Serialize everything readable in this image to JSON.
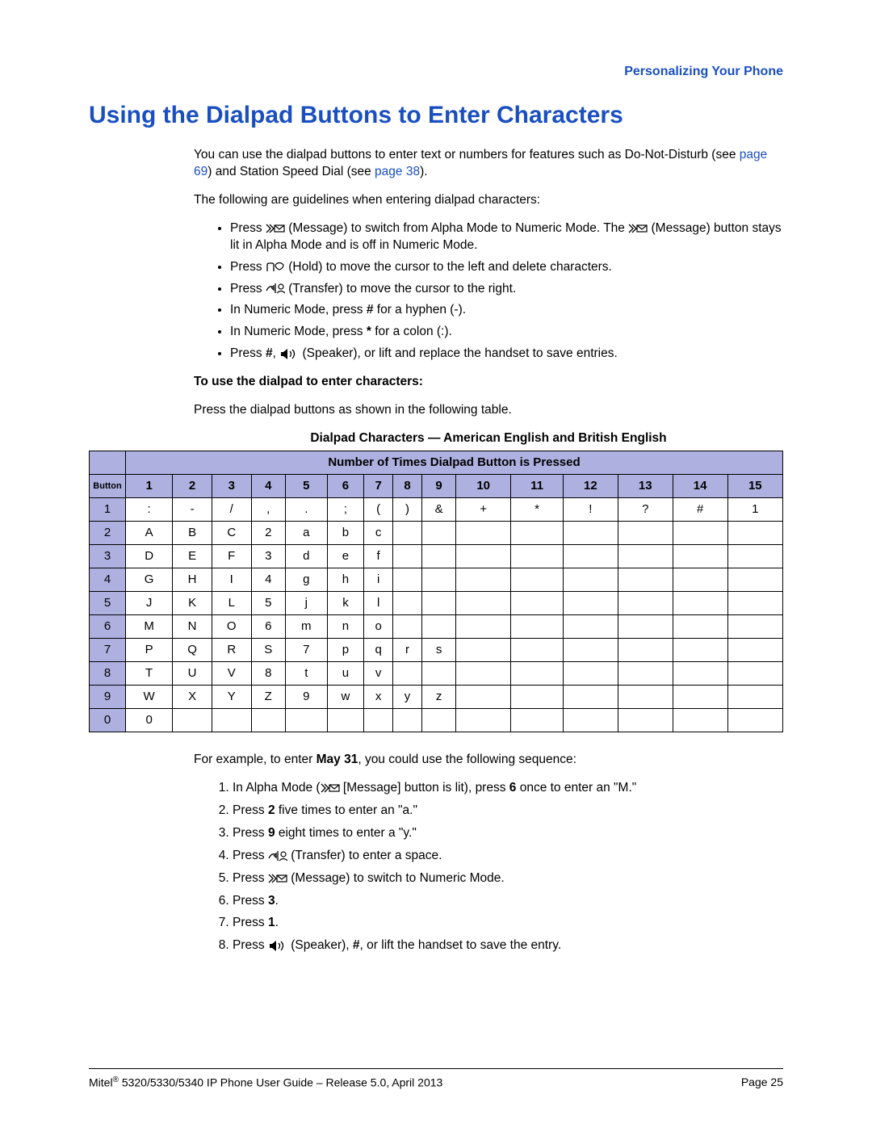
{
  "header": {
    "breadcrumb": "Personalizing Your Phone"
  },
  "title": "Using the Dialpad Buttons to Enter Characters",
  "intro": {
    "p1_a": "You can use the dialpad buttons to enter text or numbers for features such as Do-Not-Disturb (see ",
    "link1": "page 69",
    "p1_b": ") and Station Speed Dial (see ",
    "link2": "page 38",
    "p1_c": ").",
    "p2": "The following are guidelines when entering dialpad characters:"
  },
  "bullets": {
    "b1a": "Press ",
    "b1b": " (Message) to switch from Alpha Mode to Numeric Mode. The ",
    "b1c": " (Message) button stays lit in Alpha Mode and is off in Numeric Mode.",
    "b2a": "Press ",
    "b2b": " (Hold) to move the cursor to the left and delete characters.",
    "b3a": "Press ",
    "b3b": " (Transfer) to move the cursor to the right.",
    "b4a": "In Numeric Mode, press ",
    "b4b": "#",
    "b4c": " for a hyphen (-).",
    "b5a": "In Numeric Mode, press ",
    "b5b": "*",
    "b5c": " for a colon (:).",
    "b6a": "Press ",
    "b6b": "#",
    "b6c": ", ",
    "b6d": " (Speaker), or lift and replace the handset to save entries."
  },
  "instr": {
    "heading": "To use the dialpad to enter characters:",
    "p": "Press the dialpad buttons as shown in the following table."
  },
  "table": {
    "title": "Dialpad Characters — American English and British English",
    "header_span": "Number of Times Dialpad Button is Pressed",
    "button_label": "Button",
    "cols": [
      "1",
      "2",
      "3",
      "4",
      "5",
      "6",
      "7",
      "8",
      "9",
      "10",
      "11",
      "12",
      "13",
      "14",
      "15"
    ],
    "row_labels": [
      "1",
      "2",
      "3",
      "4",
      "5",
      "6",
      "7",
      "8",
      "9",
      "0"
    ],
    "chart_data": {
      "type": "table",
      "rows": [
        [
          ":",
          "-",
          "/",
          ",",
          ".",
          ";",
          "(",
          ")",
          "&",
          "+",
          "*",
          "!",
          "?",
          "#",
          "1"
        ],
        [
          "A",
          "B",
          "C",
          "2",
          "a",
          "b",
          "c",
          "",
          "",
          "",
          "",
          "",
          "",
          "",
          ""
        ],
        [
          "D",
          "E",
          "F",
          "3",
          "d",
          "e",
          "f",
          "",
          "",
          "",
          "",
          "",
          "",
          "",
          ""
        ],
        [
          "G",
          "H",
          "I",
          "4",
          "g",
          "h",
          "i",
          "",
          "",
          "",
          "",
          "",
          "",
          "",
          ""
        ],
        [
          "J",
          "K",
          "L",
          "5",
          "j",
          "k",
          "l",
          "",
          "",
          "",
          "",
          "",
          "",
          "",
          ""
        ],
        [
          "M",
          "N",
          "O",
          "6",
          "m",
          "n",
          "o",
          "",
          "",
          "",
          "",
          "",
          "",
          "",
          ""
        ],
        [
          "P",
          "Q",
          "R",
          "S",
          "7",
          "p",
          "q",
          "r",
          "s",
          "",
          "",
          "",
          "",
          "",
          ""
        ],
        [
          "T",
          "U",
          "V",
          "8",
          "t",
          "u",
          "v",
          "",
          "",
          "",
          "",
          "",
          "",
          "",
          ""
        ],
        [
          "W",
          "X",
          "Y",
          "Z",
          "9",
          "w",
          "x",
          "y",
          "z",
          "",
          "",
          "",
          "",
          "",
          ""
        ],
        [
          "0",
          "",
          "",
          "",
          "",
          "",
          "",
          "",
          "",
          "",
          "",
          "",
          "",
          "",
          ""
        ]
      ]
    }
  },
  "example": {
    "lead_a": "For example, to enter ",
    "lead_b": "May 31",
    "lead_c": ", you could use the following sequence:",
    "s1a": "In Alpha Mode (",
    "s1b": " [Message] button is lit), press ",
    "s1c": "6",
    "s1d": " once to enter an \"M.\"",
    "s2a": "Press ",
    "s2b": "2",
    "s2c": " five times to enter an \"a.\"",
    "s3a": "Press ",
    "s3b": "9",
    "s3c": " eight times to enter a \"y.\"",
    "s4a": "Press ",
    "s4b": " (Transfer) to enter a space.",
    "s5a": "Press ",
    "s5b": " (Message) to switch to Numeric Mode.",
    "s6a": "Press ",
    "s6b": "3",
    "s6c": ".",
    "s7a": "Press ",
    "s7b": "1",
    "s7c": ".",
    "s8a": "Press ",
    "s8b": " (Speaker), ",
    "s8c": "#",
    "s8d": ", or lift the handset to save the entry."
  },
  "footer": {
    "left_a": "Mitel",
    "left_sup": "®",
    "left_b": " 5320/5330/5340 IP Phone User Guide – Release 5.0, April 2013",
    "right": "Page 25"
  }
}
